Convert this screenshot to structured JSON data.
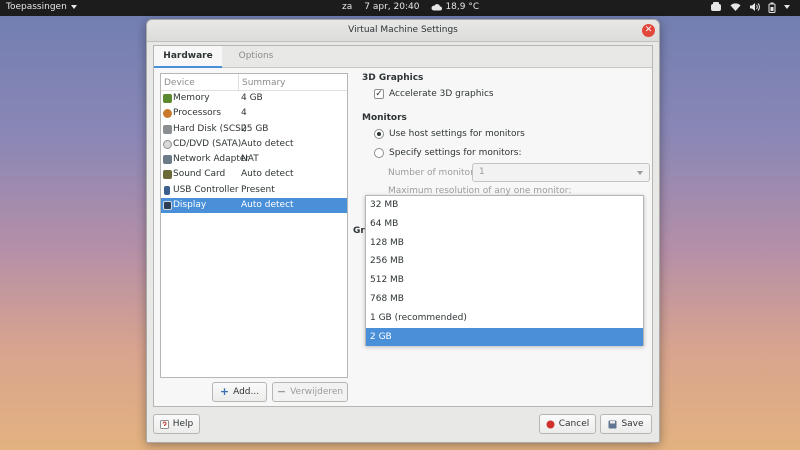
{
  "topbar": {
    "activities": "Toepassingen",
    "day": "za",
    "datetime": "7 apr, 20:40",
    "weather": "18,9 °C"
  },
  "window": {
    "title": "Virtual Machine Settings",
    "tabs": [
      {
        "label": "Hardware",
        "active": true
      },
      {
        "label": "Options",
        "active": false
      }
    ],
    "device_list": {
      "columns": [
        "Device",
        "Summary"
      ],
      "rows": [
        {
          "device": "Memory",
          "summary": "4 GB",
          "icon": "memory-icon"
        },
        {
          "device": "Processors",
          "summary": "4",
          "icon": "processor-icon"
        },
        {
          "device": "Hard Disk (SCSI)",
          "summary": "25 GB",
          "icon": "harddisk-icon"
        },
        {
          "device": "CD/DVD (SATA)",
          "summary": "Auto detect",
          "icon": "cdrom-icon"
        },
        {
          "device": "Network Adapter",
          "summary": "NAT",
          "icon": "network-icon"
        },
        {
          "device": "Sound Card",
          "summary": "Auto detect",
          "icon": "soundcard-icon"
        },
        {
          "device": "USB Controller",
          "summary": "Present",
          "icon": "usb-icon"
        },
        {
          "device": "Display",
          "summary": "Auto detect",
          "icon": "display-icon",
          "selected": true
        }
      ]
    },
    "add_button": "Add...",
    "remove_button": "Verwijderen",
    "graphics": {
      "title": "3D Graphics",
      "accelerate_label": "Accelerate 3D graphics",
      "accelerate_checked": true
    },
    "monitors": {
      "title": "Monitors",
      "option_host": "Use host settings for monitors",
      "option_specify": "Specify settings for monitors:",
      "selected_option": "host",
      "number_label": "Number of monitors:",
      "number_value": "1",
      "max_res_label": "Maximum resolution of any one monitor:"
    },
    "behind_dropdown_label": "Gr",
    "memory_dropdown": {
      "options": [
        "32 MB",
        "64 MB",
        "128 MB",
        "256 MB",
        "512 MB",
        "768 MB",
        "1 GB (recommended)",
        "2 GB"
      ],
      "selected": "2 GB"
    },
    "help_button": "Help",
    "cancel_button": "Cancel",
    "save_button": "Save"
  },
  "colors": {
    "accent": "#4a90d9",
    "close": "#e2473b",
    "topbar": "#1c1c1c"
  }
}
